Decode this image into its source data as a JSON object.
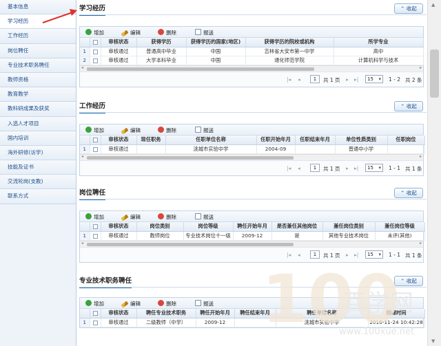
{
  "sidebar": {
    "items": [
      "基本信息",
      "学习经历",
      "工作经历",
      "岗位聘任",
      "专业技术职务聘任",
      "教师资格",
      "教育教学",
      "教科研成果及获奖",
      "入选人才项目",
      "国内培训",
      "海外研修(访学)",
      "技能及证书",
      "交流轮岗(支教)",
      "联系方式"
    ],
    "active_index": 1
  },
  "toolbar": {
    "add": "增加",
    "edit": "编辑",
    "delete": "删除",
    "report": "报送"
  },
  "collapse_label": "收起",
  "sections": [
    {
      "title": "学习经历",
      "columns": [
        "",
        "",
        "审核状态",
        "获得学历",
        "获得学历的国家(地区)",
        "获得学历的院校或机构",
        "所学专业"
      ],
      "rows": [
        [
          "1",
          "",
          "审核通过",
          "普通高中毕业",
          "中国",
          "吉林省大安市第一中学",
          "高中"
        ],
        [
          "2",
          "",
          "审核通过",
          "大学本科毕业",
          "中国",
          "通化师范学院",
          "计算机科学与技术"
        ]
      ],
      "pager": {
        "page": "1",
        "total_pages": "共 1 页",
        "page_size": "15",
        "range": "1 - 2",
        "count": "共 2 条"
      }
    },
    {
      "title": "工作经历",
      "columns": [
        "",
        "",
        "审核状态",
        "现任职务",
        "任职单位名称",
        "任职开始年月",
        "任职结束年月",
        "单位性质类别",
        "任职岗位"
      ],
      "rows": [
        [
          "1",
          "",
          "审核通过",
          "",
          "洮城市实验中学",
          "2004-09",
          "",
          "普通中小学",
          ""
        ]
      ],
      "pager": {
        "page": "1",
        "total_pages": "共 1 页",
        "page_size": "15",
        "range": "1 - 1",
        "count": "共 1 条"
      }
    },
    {
      "title": "岗位聘任",
      "columns": [
        "",
        "",
        "审核状态",
        "岗位类别",
        "岗位等级",
        "聘任开始年月",
        "是否兼任其他岗位",
        "兼任岗位类别",
        "兼任岗位等级"
      ],
      "rows": [
        [
          "1",
          "",
          "审核通过",
          "教师岗位",
          "专业技术岗位十一级",
          "2009-12",
          "是",
          "其他专业技术岗位",
          "未评(其他)"
        ]
      ],
      "pager": {
        "page": "1",
        "total_pages": "共 1 页",
        "page_size": "15",
        "range": "1 - 1",
        "count": "共 1 条"
      }
    },
    {
      "title": "专业技术职务聘任",
      "columns": [
        "",
        "",
        "审核状态",
        "聘任专业技术职务",
        "聘任开始年月",
        "聘任结束年月",
        "聘任单位名称",
        "创建时间"
      ],
      "rows": [
        [
          "1",
          "",
          "审核通过",
          "二级教师（中学）",
          "2009-12",
          "",
          "洮城市实验中学",
          "2016-11-24 10:42:28"
        ]
      ]
    }
  ],
  "watermark": {
    "digits": "100",
    "cn": "百学网",
    "url": "www.100xue.net"
  },
  "colors": {
    "accent": "#1d6fb8",
    "arrow": "#e0322d"
  }
}
